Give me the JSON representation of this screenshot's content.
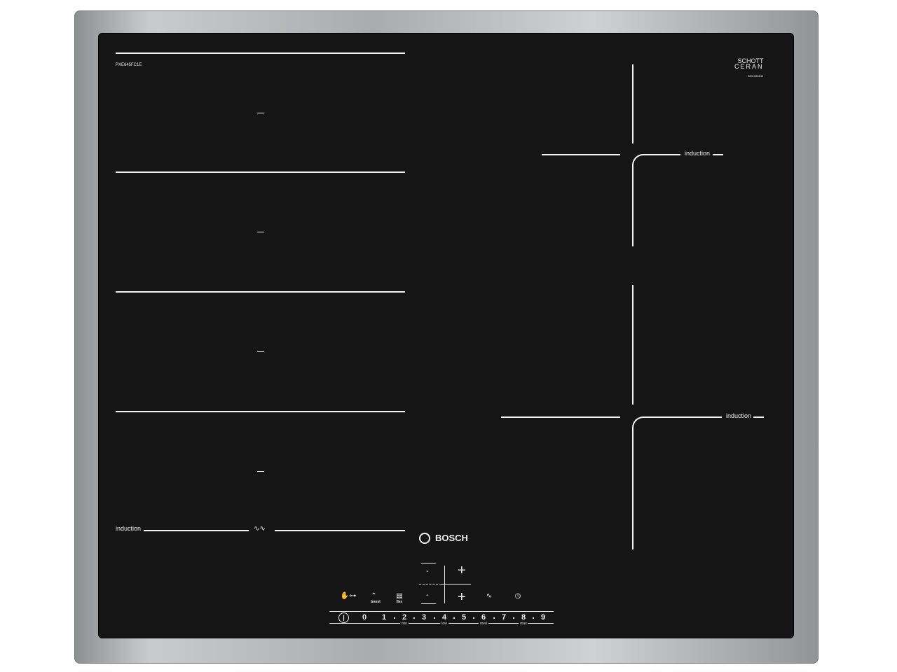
{
  "model": "PXE645FC1E",
  "brand_logo": "BOSCH",
  "glass_logo": {
    "line1": "SCHOTT",
    "line2": "CERAN",
    "code": "9001080843"
  },
  "zone_label": "induction",
  "controls": {
    "minus": "-",
    "plus": "+",
    "icons": [
      {
        "name": "childlock-icon",
        "glyph": "✋⊶",
        "label": ""
      },
      {
        "name": "boost-icon",
        "glyph": "⌃",
        "label": "boost"
      },
      {
        "name": "flex-icon",
        "glyph": "▤",
        "label": "flex"
      },
      {
        "name": "flex-move-icon",
        "glyph": "∿",
        "label": ""
      },
      {
        "name": "timer-icon",
        "glyph": "◷",
        "label": ""
      }
    ],
    "power_glyph": "|",
    "levels": [
      "0",
      "1",
      "2",
      "3",
      "4",
      "5",
      "6",
      "7",
      "8",
      "9"
    ],
    "level_labels": {
      "2": "min",
      "4": "low",
      "6": "med",
      "8": "max"
    }
  }
}
